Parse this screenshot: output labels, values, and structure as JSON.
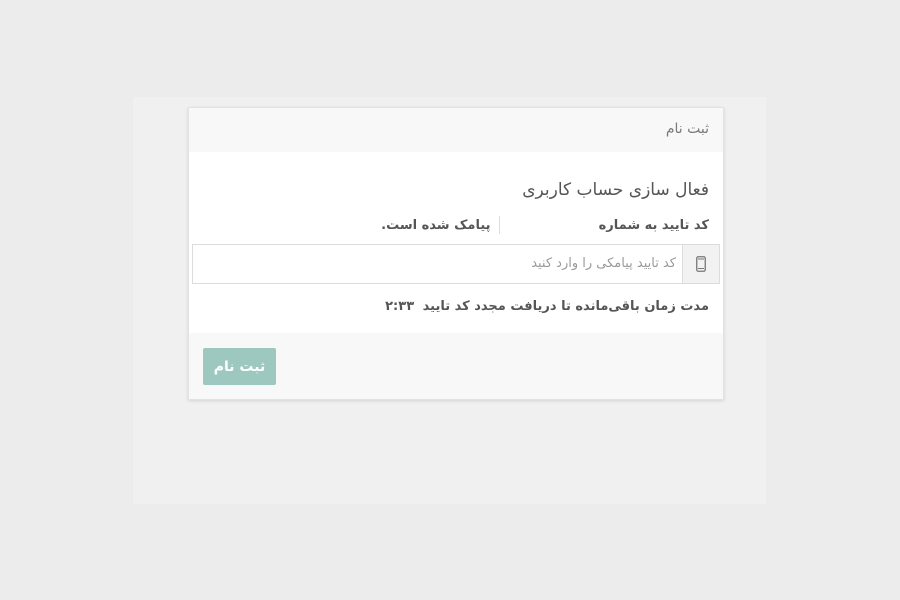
{
  "card": {
    "header_title": "ثبت نام",
    "heading": "فعال سازی حساب کاربری",
    "info_label": "کد تایید به شماره",
    "info_suffix": "پیامک شده است.",
    "input": {
      "placeholder": "کد تایید پیامکی را وارد کنید",
      "value": "",
      "icon": "mobile-phone-icon"
    },
    "timer_label": "مدت زمان باقی‌مانده تا دریافت مجدد کد تایید",
    "timer_value": "۲:۳۳",
    "submit_label": "ثبت نام"
  },
  "colors": {
    "page_bg": "#ececec",
    "card_bg": "#ffffff",
    "header_bg": "#f8f8f8",
    "button_bg": "#9cc8bf",
    "button_text": "#ffffff"
  }
}
